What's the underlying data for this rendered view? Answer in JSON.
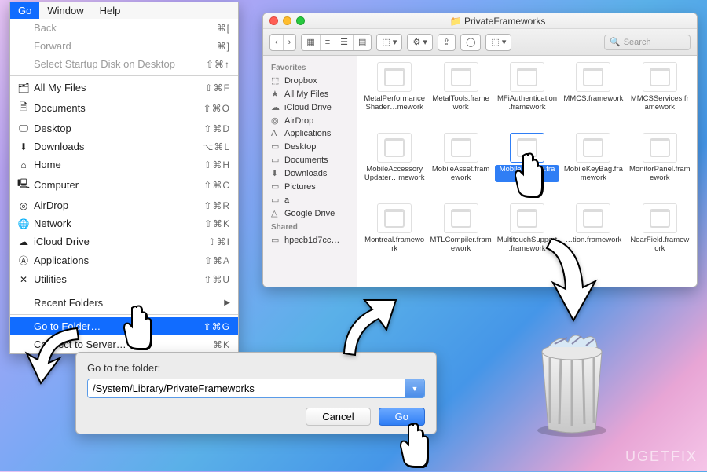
{
  "menubar": {
    "go": "Go",
    "window": "Window",
    "help": "Help"
  },
  "menu": {
    "back": "Back",
    "back_sc": "⌘[",
    "forward": "Forward",
    "forward_sc": "⌘]",
    "startup": "Select Startup Disk on Desktop",
    "startup_sc": "⇧⌘↑",
    "allfiles": "All My Files",
    "allfiles_sc": "⇧⌘F",
    "documents": "Documents",
    "documents_sc": "⇧⌘O",
    "desktop": "Desktop",
    "desktop_sc": "⇧⌘D",
    "downloads": "Downloads",
    "downloads_sc": "⌥⌘L",
    "home": "Home",
    "home_sc": "⇧⌘H",
    "computer": "Computer",
    "computer_sc": "⇧⌘C",
    "airdrop": "AirDrop",
    "airdrop_sc": "⇧⌘R",
    "network": "Network",
    "network_sc": "⇧⌘K",
    "icloud": "iCloud Drive",
    "icloud_sc": "⇧⌘I",
    "applications": "Applications",
    "applications_sc": "⇧⌘A",
    "utilities": "Utilities",
    "utilities_sc": "⇧⌘U",
    "recent": "Recent Folders",
    "goto": "Go to Folder…",
    "goto_sc": "⇧⌘G",
    "connect": "Connect to Server…",
    "connect_sc": "⌘K"
  },
  "goto_dialog": {
    "label": "Go to the folder:",
    "path": "/System/Library/PrivateFrameworks",
    "cancel": "Cancel",
    "go": "Go"
  },
  "finder": {
    "title": "PrivateFrameworks",
    "search_placeholder": "Search",
    "sidebar": {
      "favorites": "Favorites",
      "items": [
        {
          "icon": "⬚",
          "label": "Dropbox"
        },
        {
          "icon": "★",
          "label": "All My Files"
        },
        {
          "icon": "☁",
          "label": "iCloud Drive"
        },
        {
          "icon": "◎",
          "label": "AirDrop"
        },
        {
          "icon": "A",
          "label": "Applications"
        },
        {
          "icon": "▭",
          "label": "Desktop"
        },
        {
          "icon": "▭",
          "label": "Documents"
        },
        {
          "icon": "⬇",
          "label": "Downloads"
        },
        {
          "icon": "▭",
          "label": "Pictures"
        },
        {
          "icon": "▭",
          "label": "a"
        },
        {
          "icon": "△",
          "label": "Google Drive"
        }
      ],
      "shared": "Shared",
      "shared_items": [
        {
          "icon": "▭",
          "label": "hpecb1d7cc…"
        }
      ]
    },
    "files": [
      "MetalPerformanceShader…mework",
      "MetalTools.framework",
      "MFiAuthentication.framework",
      "MMCS.framework",
      "MMCSServices.framework",
      "MobileAccessoryUpdater…mework",
      "MobileAsset.framework",
      "MobileDevice.framework",
      "MobileKeyBag.framework",
      "MonitorPanel.framework",
      "Montreal.framework",
      "MTLCompiler.framework",
      "MultitouchSupport.framework",
      "…tion.framework",
      "NearField.framework"
    ],
    "selected_index": 7
  },
  "watermark": "UGETFIX"
}
